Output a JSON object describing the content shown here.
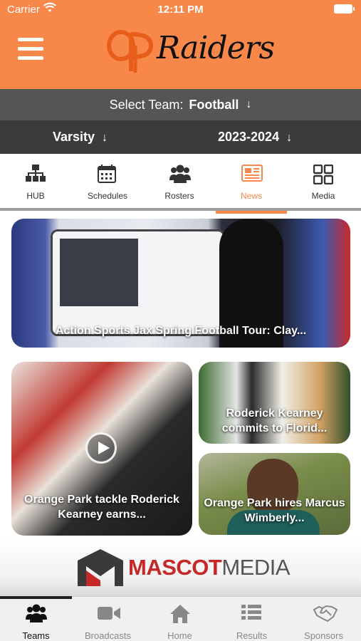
{
  "status_bar": {
    "carrier": "Carrier",
    "time": "12:11 PM"
  },
  "header": {
    "logo_initials": "OP",
    "logo_text": "Raiders",
    "accent_color": "#f7884a"
  },
  "team_select": {
    "label": "Select Team:",
    "value": "Football"
  },
  "filters": {
    "level": "Varsity",
    "season": "2023-2024"
  },
  "tabs": [
    {
      "label": "HUB",
      "icon": "org-chart-icon"
    },
    {
      "label": "Schedules",
      "icon": "calendar-icon"
    },
    {
      "label": "Rosters",
      "icon": "users-icon"
    },
    {
      "label": "News",
      "icon": "newspaper-icon",
      "active": true
    },
    {
      "label": "Media",
      "icon": "grid-icon"
    }
  ],
  "news": {
    "featured": {
      "title": "Action Sports Jax Spring Football Tour: Clay..."
    },
    "video": {
      "title": "Orange Park tackle Roderick Kearney earns..."
    },
    "side1": {
      "title": "Roderick Kearney commits to Florid..."
    },
    "side2": {
      "title": "Orange Park hires Marcus Wimberly..."
    }
  },
  "sponsor": {
    "name_part1": "MASCOT",
    "name_part2": "MEDIA"
  },
  "bottom_nav": [
    {
      "label": "Teams",
      "icon": "team-icon",
      "active": true
    },
    {
      "label": "Broadcasts",
      "icon": "video-camera-icon"
    },
    {
      "label": "Home",
      "icon": "home-icon"
    },
    {
      "label": "Results",
      "icon": "list-icon"
    },
    {
      "label": "Sponsors",
      "icon": "handshake-icon"
    }
  ]
}
